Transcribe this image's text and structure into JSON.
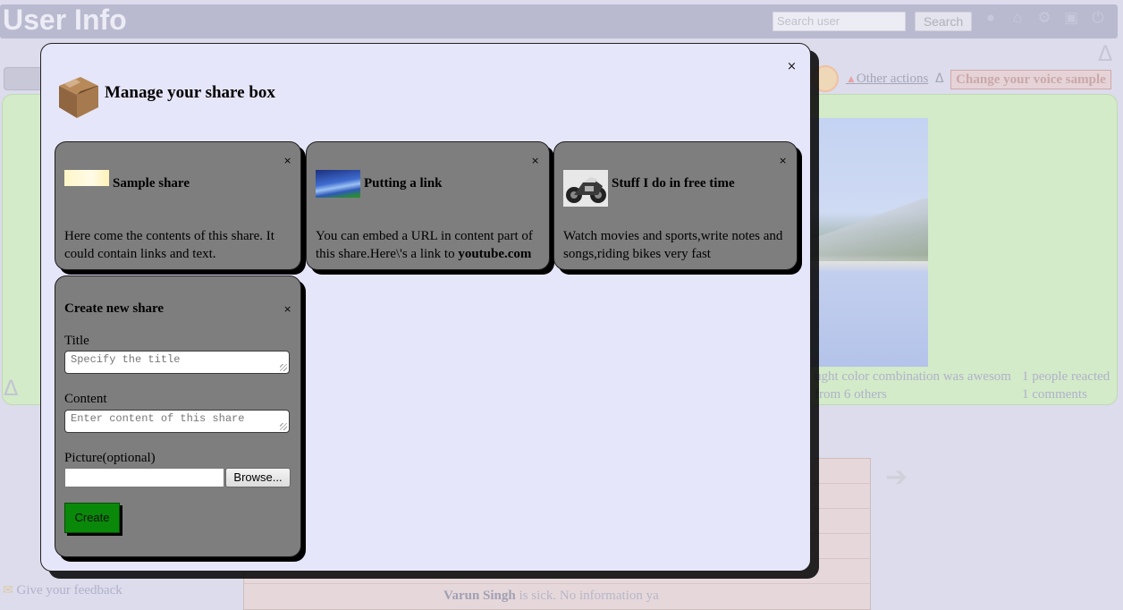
{
  "header": {
    "app_title": "User Info",
    "search_placeholder": "Search user",
    "search_button": "Search"
  },
  "actions": {
    "other_actions": "Other actions",
    "change_voice": "Change your voice sample"
  },
  "background_post": {
    "comment_snippet": "ught color combination was awesom",
    "reactions": "1 people reacted",
    "from_others": "from 6 others",
    "comments": "1 comments"
  },
  "footer": {
    "feedback": "Give your feedback",
    "user_name": "Varun Singh",
    "user_status": "is sick. No information ya"
  },
  "modal": {
    "title": "Manage your share box",
    "close_glyph": "×",
    "shares": [
      {
        "title": "Sample share",
        "body": "Here come the contents of this share. It could contain links and text.",
        "close_glyph": "×"
      },
      {
        "title": "Putting a link",
        "body_prefix": "You can embed a URL in content part of this share.Here\\'s a link to ",
        "body_link": "youtube.com",
        "close_glyph": "×"
      },
      {
        "title": "Stuff I do in free time",
        "body": "Watch movies and sports,write notes and songs,riding bikes very fast",
        "close_glyph": "×"
      }
    ],
    "create_form": {
      "heading": "Create new share",
      "close_glyph": "×",
      "title_label": "Title",
      "title_placeholder": "Specify the title",
      "content_label": "Content",
      "content_placeholder": "Enter content of this share",
      "picture_label": "Picture(optional)",
      "browse_button": "Browse...",
      "create_button": "Create"
    }
  },
  "colors": {
    "modal_bg": "#e6e6fa",
    "card_bg": "#7e7e7e",
    "create_button": "#0a880a",
    "background_green_panel": "#d3ebc9"
  }
}
